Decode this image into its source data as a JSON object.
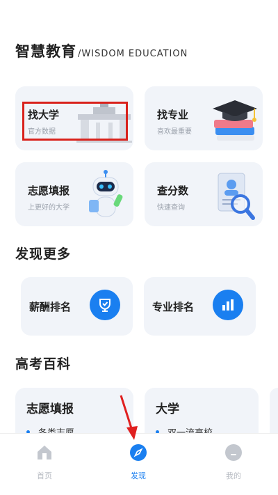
{
  "header": {
    "title": "智慧教育",
    "subtitle": "/WISDOM EDUCATION"
  },
  "cards": [
    {
      "title": "找大学",
      "subtitle": "官方数据",
      "icon": "university-gate-icon"
    },
    {
      "title": "找专业",
      "subtitle": "喜欢最重要",
      "icon": "graduation-cap-books-icon"
    },
    {
      "title": "志愿填报",
      "subtitle": "上更好的大学",
      "icon": "robot-icon"
    },
    {
      "title": "查分数",
      "subtitle": "快速查询",
      "icon": "document-magnifier-icon"
    }
  ],
  "discover": {
    "title": "发现更多",
    "items": [
      {
        "label": "薪酬排名",
        "icon": "trophy-shield-icon"
      },
      {
        "label": "专业排名",
        "icon": "bar-chart-icon"
      }
    ]
  },
  "encyclopedia": {
    "title": "高考百科",
    "cards": [
      {
        "title": "志愿填报",
        "item": "各类志愿"
      },
      {
        "title": "大学",
        "item": "双一流高校"
      }
    ]
  },
  "tabbar": {
    "items": [
      {
        "label": "首页",
        "icon": "home-icon"
      },
      {
        "label": "发现",
        "icon": "compass-icon"
      },
      {
        "label": "我的",
        "icon": "profile-icon"
      }
    ],
    "active": "发现"
  },
  "colors": {
    "accent": "#1a7ff0",
    "card_bg": "#f1f4f9",
    "highlight": "#d9211b",
    "arrow": "#e02020"
  }
}
